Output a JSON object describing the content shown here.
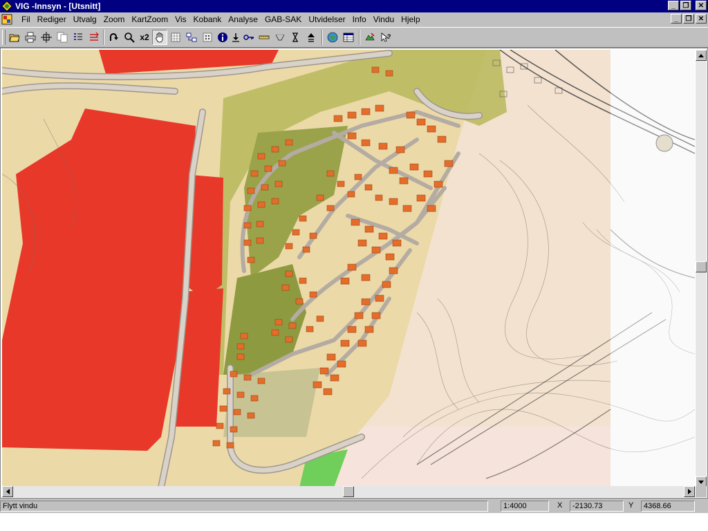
{
  "window": {
    "title": "VIG -Innsyn - [Utsnitt]",
    "minimize": "_",
    "restore": "❐",
    "close": "✕"
  },
  "menubar": {
    "items": [
      {
        "id": "fil",
        "label": "Fil"
      },
      {
        "id": "rediger",
        "label": "Rediger"
      },
      {
        "id": "utvalg",
        "label": "Utvalg"
      },
      {
        "id": "zoom",
        "label": "Zoom"
      },
      {
        "id": "kartzoom",
        "label": "KartZoom"
      },
      {
        "id": "vis",
        "label": "Vis"
      },
      {
        "id": "kobank",
        "label": "Kobank"
      },
      {
        "id": "analyse",
        "label": "Analyse"
      },
      {
        "id": "gab-sak",
        "label": "GAB-SAK"
      },
      {
        "id": "utvidelser",
        "label": "Utvidelser"
      },
      {
        "id": "info",
        "label": "Info"
      },
      {
        "id": "vindu",
        "label": "Vindu"
      },
      {
        "id": "hjelp",
        "label": "Hjelp"
      }
    ]
  },
  "toolbar": {
    "zoom_x2_label": "x2",
    "icons": [
      "open-folder-icon",
      "print-icon",
      "select-cross-icon",
      "copy-icon",
      "list-icon",
      "chart-list-icon",
      "undo-arrow-icon",
      "magnifier-icon",
      "pan-hand-icon",
      "grid-icon",
      "layers-icon",
      "grid-dots-icon",
      "info-icon",
      "download-icon",
      "key-icon",
      "ruler-icon",
      "measure-icon",
      "hourglass-icon",
      "up-arrow-icon",
      "globe-icon",
      "table-icon",
      "map-edit-icon",
      "help-pointer-icon"
    ],
    "active_tool": "pan-hand-icon"
  },
  "map": {
    "scale_label": "1:4000",
    "colors": {
      "zoning_red": "#e8382a",
      "residential_yellow": "#f2d9a0",
      "green_area": "#9aa34a",
      "road": "#c9c2b8",
      "house": "#e56d2a",
      "terrain": "#f3e1cf",
      "park_green": "#6fcf5a"
    }
  },
  "statusbar": {
    "message": "Flytt vindu",
    "scale": "1:4000",
    "x_label": "X",
    "x_value": "-2130.73",
    "y_label": "Y",
    "y_value": "4368.66"
  }
}
